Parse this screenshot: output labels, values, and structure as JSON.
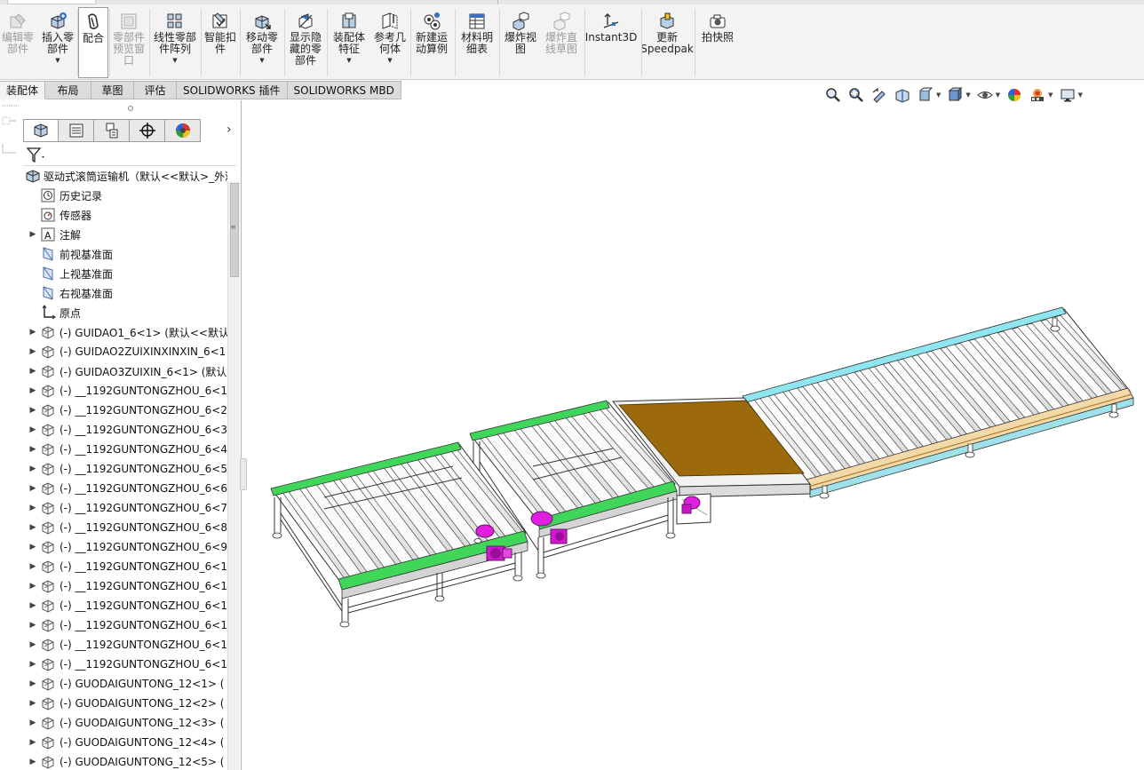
{
  "ribbon": {
    "buttons": [
      {
        "label": "编辑零\n部件",
        "icon": "edit-component-icon",
        "disabled": true
      },
      {
        "label": "插入零\n部件",
        "icon": "insert-component-icon",
        "dropdown": true
      },
      {
        "label": "配合",
        "icon": "mate-icon",
        "selected": true
      },
      {
        "label": "零部件\n预览窗\n口",
        "icon": "component-preview-icon",
        "disabled": true
      },
      {
        "label": "线性零部\n件阵列",
        "icon": "linear-pattern-icon",
        "dropdown": true
      },
      {
        "label": "智能扣\n件",
        "icon": "smart-fasteners-icon"
      },
      {
        "label": "移动零\n部件",
        "icon": "move-component-icon",
        "dropdown": true
      },
      {
        "label": "显示隐\n藏的零\n部件",
        "icon": "show-hidden-icon"
      },
      {
        "label": "装配体\n特征",
        "icon": "assembly-features-icon",
        "dropdown": true
      },
      {
        "label": "参考几\n何体",
        "icon": "reference-geometry-icon",
        "dropdown": true
      },
      {
        "label": "新建运\n动算例",
        "icon": "motion-study-icon"
      },
      {
        "label": "材料明\n细表",
        "icon": "bom-icon"
      },
      {
        "label": "爆炸视\n图",
        "icon": "exploded-view-icon"
      },
      {
        "label": "爆炸直\n线草图",
        "icon": "explode-line-sketch-icon",
        "disabled": true
      },
      {
        "label": "Instant3D",
        "icon": "instant3d-icon"
      },
      {
        "label": "更新\nSpeedpak",
        "icon": "speedpak-icon"
      },
      {
        "label": "拍快照",
        "icon": "snapshot-icon"
      }
    ]
  },
  "tabs": [
    "装配体",
    "布局",
    "草图",
    "评估",
    "SOLIDWORKS 插件",
    "SOLIDWORKS MBD"
  ],
  "tree": {
    "root": "驱动式滚筒运输机（默认<<默认>_外观",
    "items": [
      {
        "label": "历史记录",
        "icon": "history-icon",
        "expand": false
      },
      {
        "label": "传感器",
        "icon": "sensor-icon",
        "expand": false
      },
      {
        "label": "注解",
        "icon": "annotation-icon",
        "expand": true
      },
      {
        "label": "前视基准面",
        "icon": "plane-icon",
        "expand": false
      },
      {
        "label": "上视基准面",
        "icon": "plane-icon",
        "expand": false
      },
      {
        "label": "右视基准面",
        "icon": "plane-icon",
        "expand": false
      },
      {
        "label": "原点",
        "icon": "origin-icon",
        "expand": false
      },
      {
        "label": "(-) GUIDAO1_6<1> (默认<<默认",
        "icon": "part-icon",
        "expand": true
      },
      {
        "label": "(-) GUIDAO2ZUIXINXINXIN_6<1",
        "icon": "part-icon",
        "expand": true
      },
      {
        "label": "(-) GUIDAO3ZUIXIN_6<1> (默认",
        "icon": "part-icon",
        "expand": true
      },
      {
        "label": "(-) __1192GUNTONGZHOU_6<1",
        "icon": "part-icon",
        "expand": true
      },
      {
        "label": "(-) __1192GUNTONGZHOU_6<2",
        "icon": "part-icon",
        "expand": true
      },
      {
        "label": "(-) __1192GUNTONGZHOU_6<3",
        "icon": "part-icon",
        "expand": true
      },
      {
        "label": "(-) __1192GUNTONGZHOU_6<4",
        "icon": "part-icon",
        "expand": true
      },
      {
        "label": "(-) __1192GUNTONGZHOU_6<5",
        "icon": "part-icon",
        "expand": true
      },
      {
        "label": "(-) __1192GUNTONGZHOU_6<6",
        "icon": "part-icon",
        "expand": true
      },
      {
        "label": "(-) __1192GUNTONGZHOU_6<7",
        "icon": "part-icon",
        "expand": true
      },
      {
        "label": "(-) __1192GUNTONGZHOU_6<8",
        "icon": "part-icon",
        "expand": true
      },
      {
        "label": "(-) __1192GUNTONGZHOU_6<9",
        "icon": "part-icon",
        "expand": true
      },
      {
        "label": "(-) __1192GUNTONGZHOU_6<1",
        "icon": "part-icon",
        "expand": true
      },
      {
        "label": "(-) __1192GUNTONGZHOU_6<1",
        "icon": "part-icon",
        "expand": true
      },
      {
        "label": "(-) __1192GUNTONGZHOU_6<1",
        "icon": "part-icon",
        "expand": true
      },
      {
        "label": "(-) __1192GUNTONGZHOU_6<1",
        "icon": "part-icon",
        "expand": true
      },
      {
        "label": "(-) __1192GUNTONGZHOU_6<1",
        "icon": "part-icon",
        "expand": true
      },
      {
        "label": "(-) __1192GUNTONGZHOU_6<1",
        "icon": "part-icon",
        "expand": true
      },
      {
        "label": "(-) GUODAIGUNTONG_12<1> (",
        "icon": "part-icon",
        "expand": true
      },
      {
        "label": "(-) GUODAIGUNTONG_12<2> (",
        "icon": "part-icon",
        "expand": true
      },
      {
        "label": "(-) GUODAIGUNTONG_12<3> (",
        "icon": "part-icon",
        "expand": true
      },
      {
        "label": "(-) GUODAIGUNTONG_12<4> (",
        "icon": "part-icon",
        "expand": true
      },
      {
        "label": "(-) GUODAIGUNTONG_12<5> (",
        "icon": "part-icon",
        "expand": true
      }
    ]
  },
  "colors": {
    "ribbon_bg": "#f3f3f3",
    "green_rail": "#3fd65a",
    "cyan_rail": "#8fe6f0",
    "plate": "#9c6a0a",
    "motor": "#e21ee0",
    "edge": "#3a3a3a"
  }
}
